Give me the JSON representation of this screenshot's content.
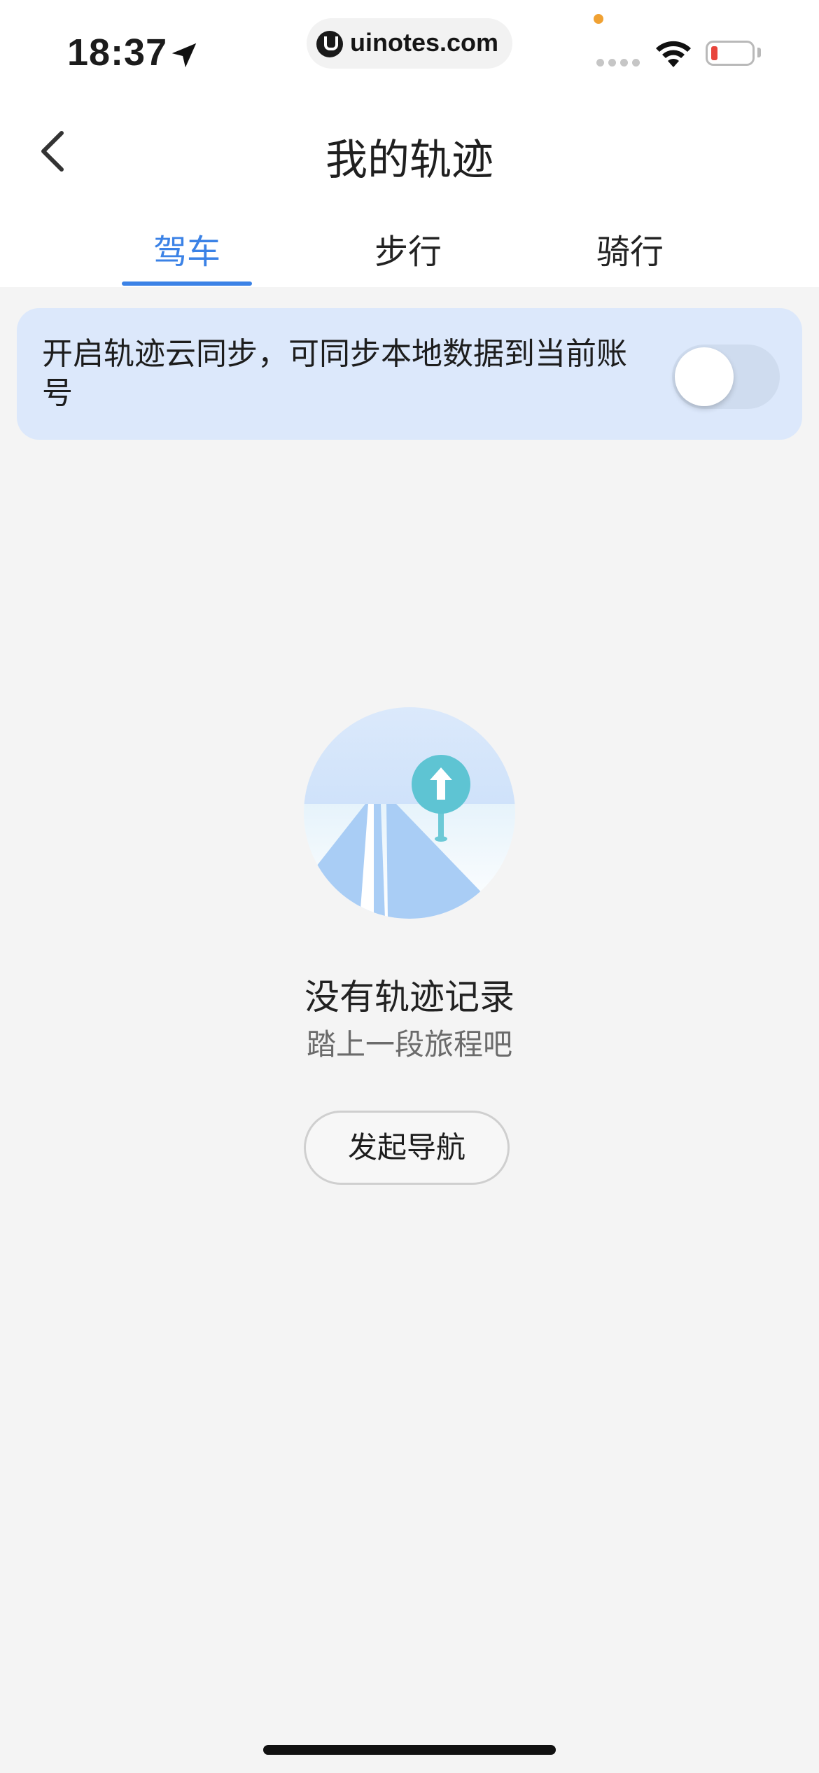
{
  "status_bar": {
    "time": "18:37",
    "url": "uinotes.com",
    "icons": [
      "location-arrow-icon",
      "wifi-icon",
      "battery-icon",
      "signal-icon"
    ],
    "battery_color": "#e8453c",
    "indicator_dot_color": "#f0a132"
  },
  "header": {
    "title": "我的轨迹",
    "back_icon": "chevron-left-icon"
  },
  "tabs": [
    {
      "label": "驾车",
      "active": true
    },
    {
      "label": "步行",
      "active": false
    },
    {
      "label": "骑行",
      "active": false
    }
  ],
  "sync_banner": {
    "text": "开启轨迹云同步，可同步本地数据到当前账号",
    "toggle_on": false
  },
  "empty_state": {
    "illustration": "road-with-arrow-sign-icon",
    "title": "没有轨迹记录",
    "subtitle": "踏上一段旅程吧",
    "button_label": "发起导航"
  },
  "colors": {
    "accent": "#3b82e6",
    "banner_bg": "#dce8fb",
    "page_bg": "#f4f4f4"
  }
}
